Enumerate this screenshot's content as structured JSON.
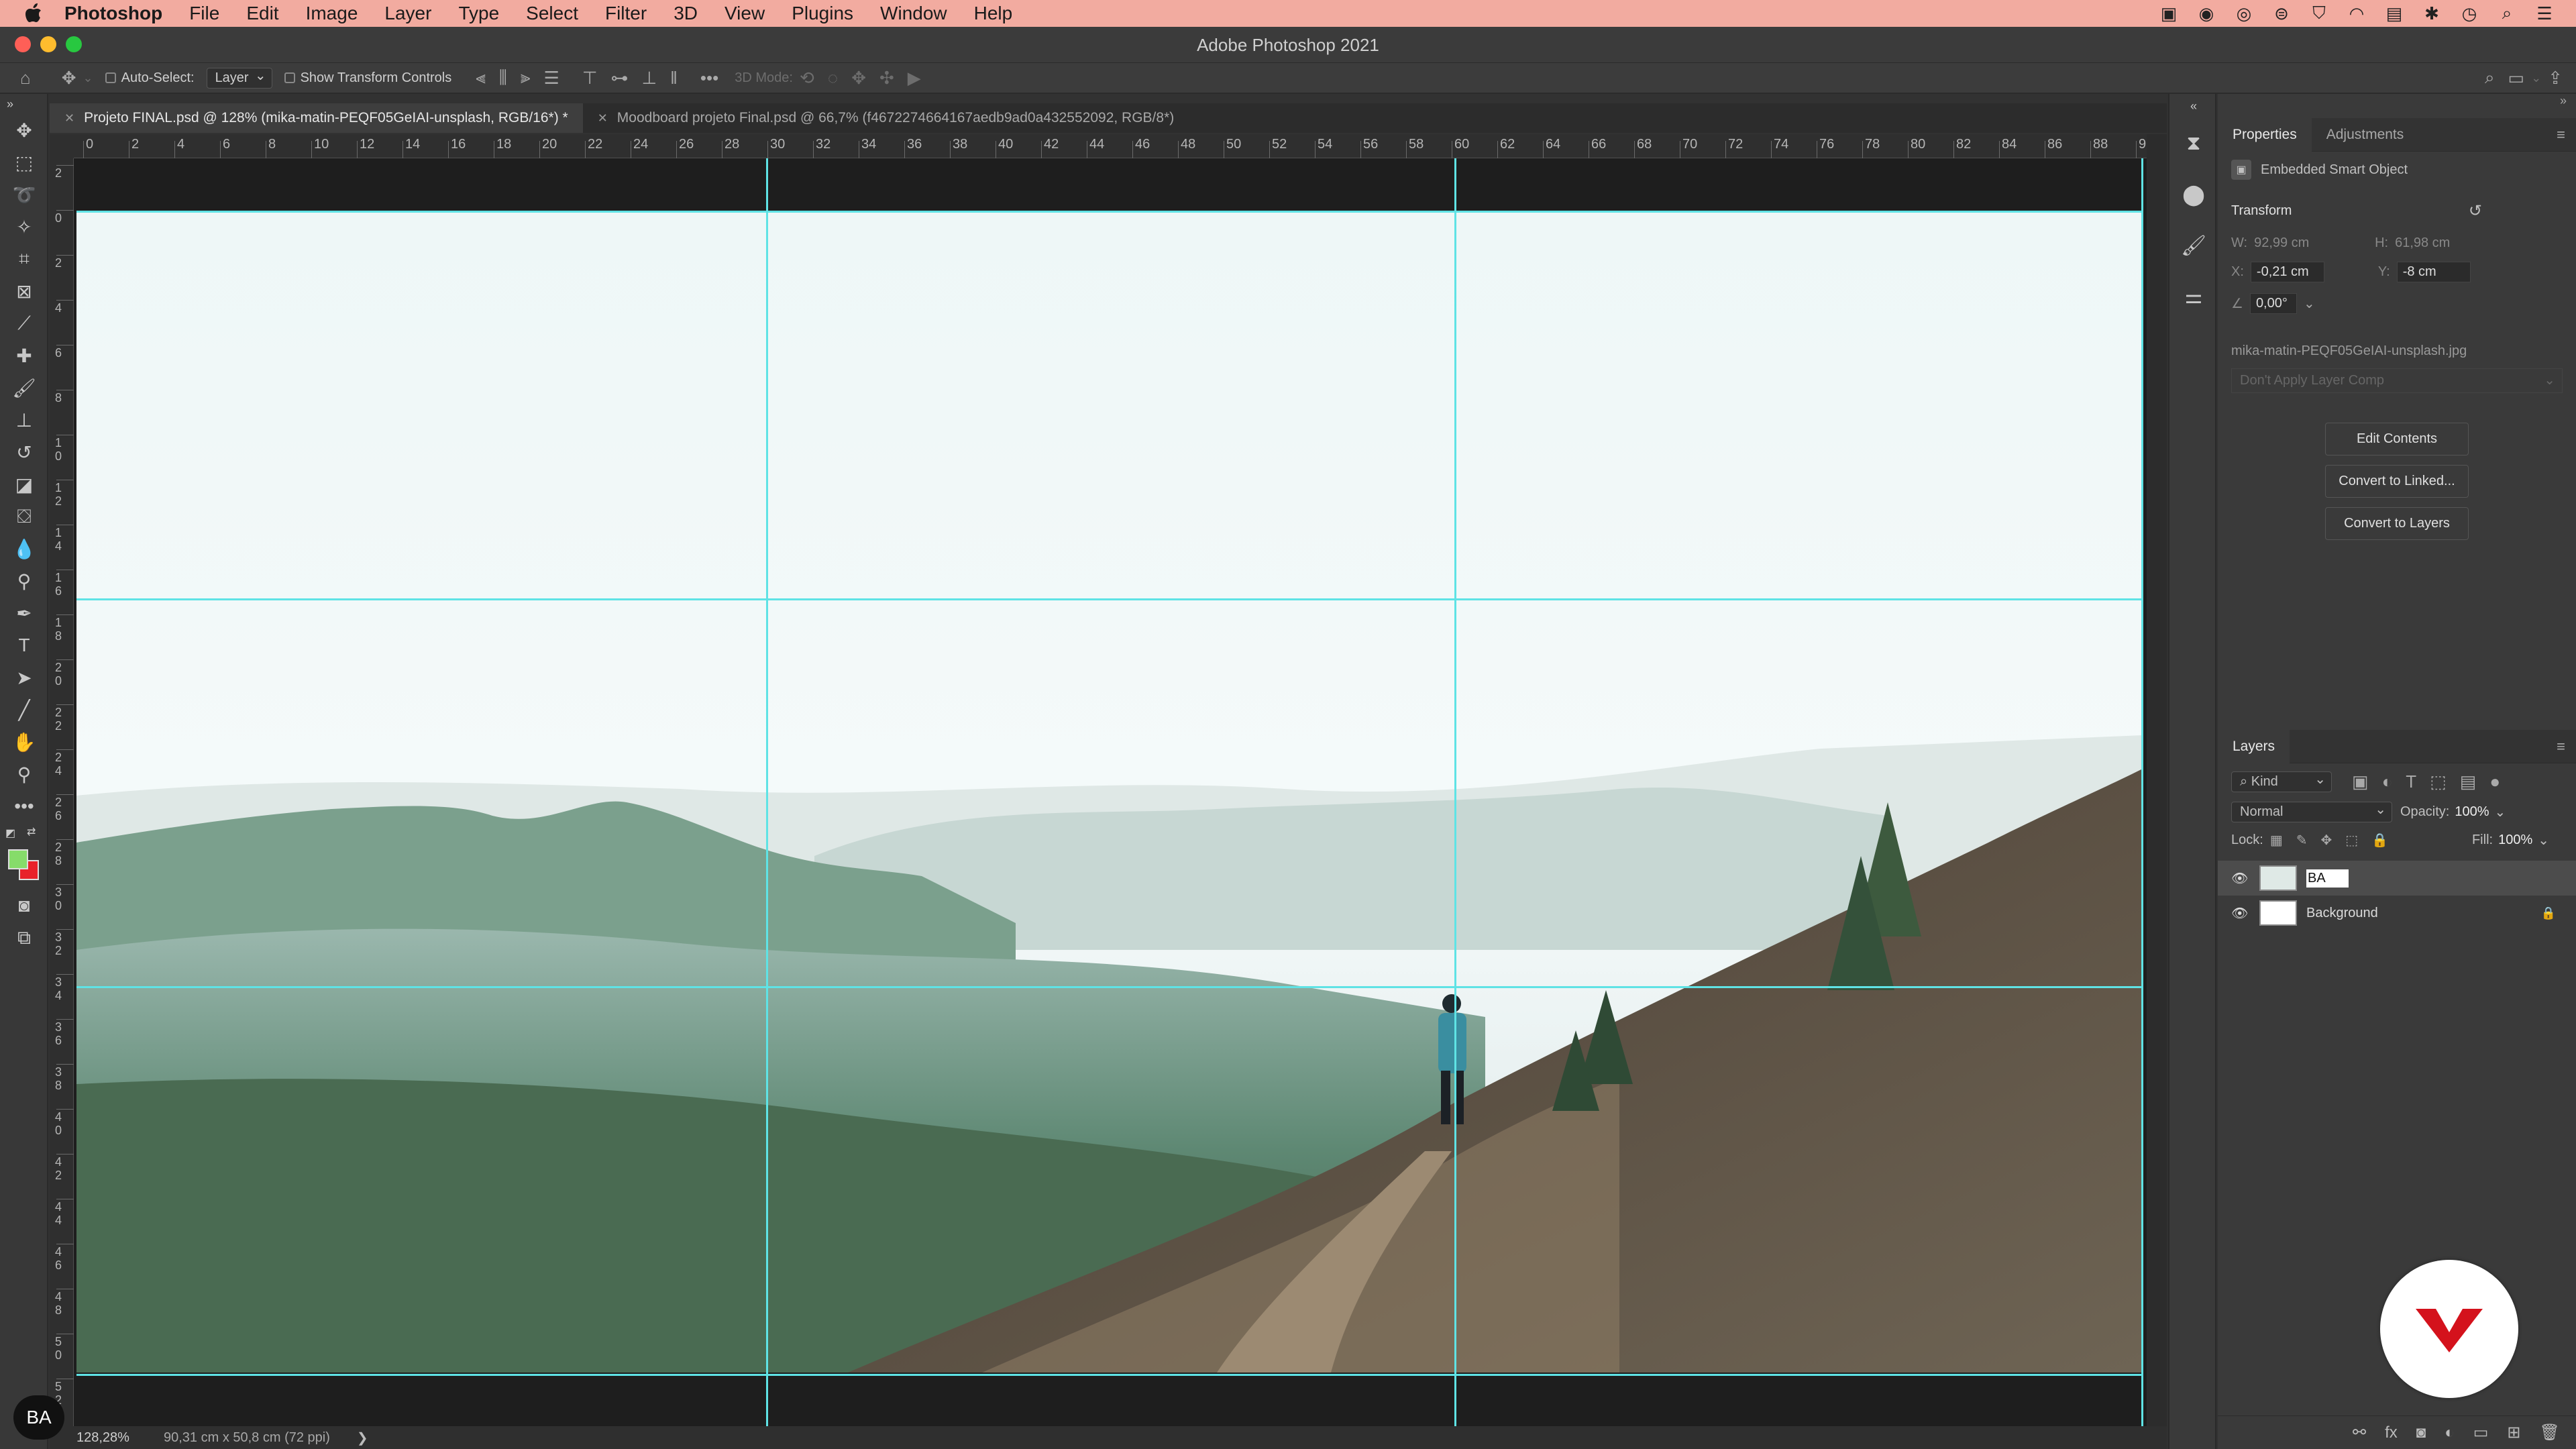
{
  "menubar": {
    "app": "Photoshop",
    "items": [
      "File",
      "Edit",
      "Image",
      "Layer",
      "Type",
      "Select",
      "Filter",
      "3D",
      "View",
      "Plugins",
      "Window",
      "Help"
    ]
  },
  "window": {
    "title": "Adobe Photoshop 2021"
  },
  "options": {
    "auto_select_label": "Auto-Select:",
    "auto_select_value": "Layer",
    "transform_label": "Show Transform Controls",
    "mode_3d_label": "3D Mode:"
  },
  "tabs": [
    {
      "label": "Projeto FINAL.psd @ 128% (mika-matin-PEQF05GeIAI-unsplash, RGB/16*) *"
    },
    {
      "label": "Moodboard projeto Final.psd @ 66,7% (f4672274664167aedb9ad0a432552092, RGB/8*)"
    }
  ],
  "ruler": {
    "h_labels": [
      "0",
      "2",
      "4",
      "6",
      "8",
      "10",
      "12",
      "14",
      "16",
      "18",
      "20",
      "22",
      "24",
      "26",
      "28",
      "30",
      "32",
      "34",
      "36",
      "38",
      "40",
      "42",
      "44",
      "46",
      "48",
      "50",
      "52",
      "54",
      "56",
      "58",
      "60",
      "62",
      "64",
      "66",
      "68",
      "70",
      "72",
      "74",
      "76",
      "78",
      "80",
      "82",
      "84",
      "86",
      "88",
      "9"
    ],
    "v_labels": [
      "2",
      "0",
      "2",
      "4",
      "6",
      "8",
      "1\n0",
      "1\n2",
      "1\n4",
      "1\n6",
      "1\n8",
      "2\n0",
      "2\n2",
      "2\n4",
      "2\n6",
      "2\n8",
      "3\n0",
      "3\n2",
      "3\n4",
      "3\n6",
      "3\n8",
      "4\n0",
      "4\n2",
      "4\n4",
      "4\n6",
      "4\n8",
      "5\n0",
      "5\n2"
    ]
  },
  "status": {
    "zoom": "128,28%",
    "doc_info": "90,31 cm x 50,8 cm (72 ppi)",
    "arrow": "❯"
  },
  "bubble": {
    "text": "BA"
  },
  "properties": {
    "tab_properties": "Properties",
    "tab_adjustments": "Adjustments",
    "object_type": "Embedded Smart Object",
    "transform_title": "Transform",
    "w_label": "W:",
    "w_value": "92,99 cm",
    "h_label": "H:",
    "h_value": "61,98 cm",
    "x_label": "X:",
    "x_value": "-0,21 cm",
    "y_label": "Y:",
    "y_value": "-8 cm",
    "angle_value": "0,00°",
    "filename": "mika-matin-PEQF05GeIAI-unsplash.jpg",
    "layer_comp": "Don't Apply Layer Comp",
    "btn_edit": "Edit Contents",
    "btn_linked": "Convert to Linked...",
    "btn_layers": "Convert to Layers"
  },
  "layers": {
    "title": "Layers",
    "kind": "Kind",
    "blend": "Normal",
    "opacity_label": "Opacity:",
    "opacity_value": "100%",
    "lock_label": "Lock:",
    "fill_label": "Fill:",
    "fill_value": "100%",
    "items": [
      {
        "name": "BA",
        "editing": true
      },
      {
        "name": "Background",
        "locked": true
      }
    ]
  },
  "colors": {
    "menubar": "#f2aba0",
    "guide": "#5fe3e5",
    "foreground": "#86dc6a",
    "background_color": "#e8222a",
    "brand_red": "#d4121c"
  }
}
